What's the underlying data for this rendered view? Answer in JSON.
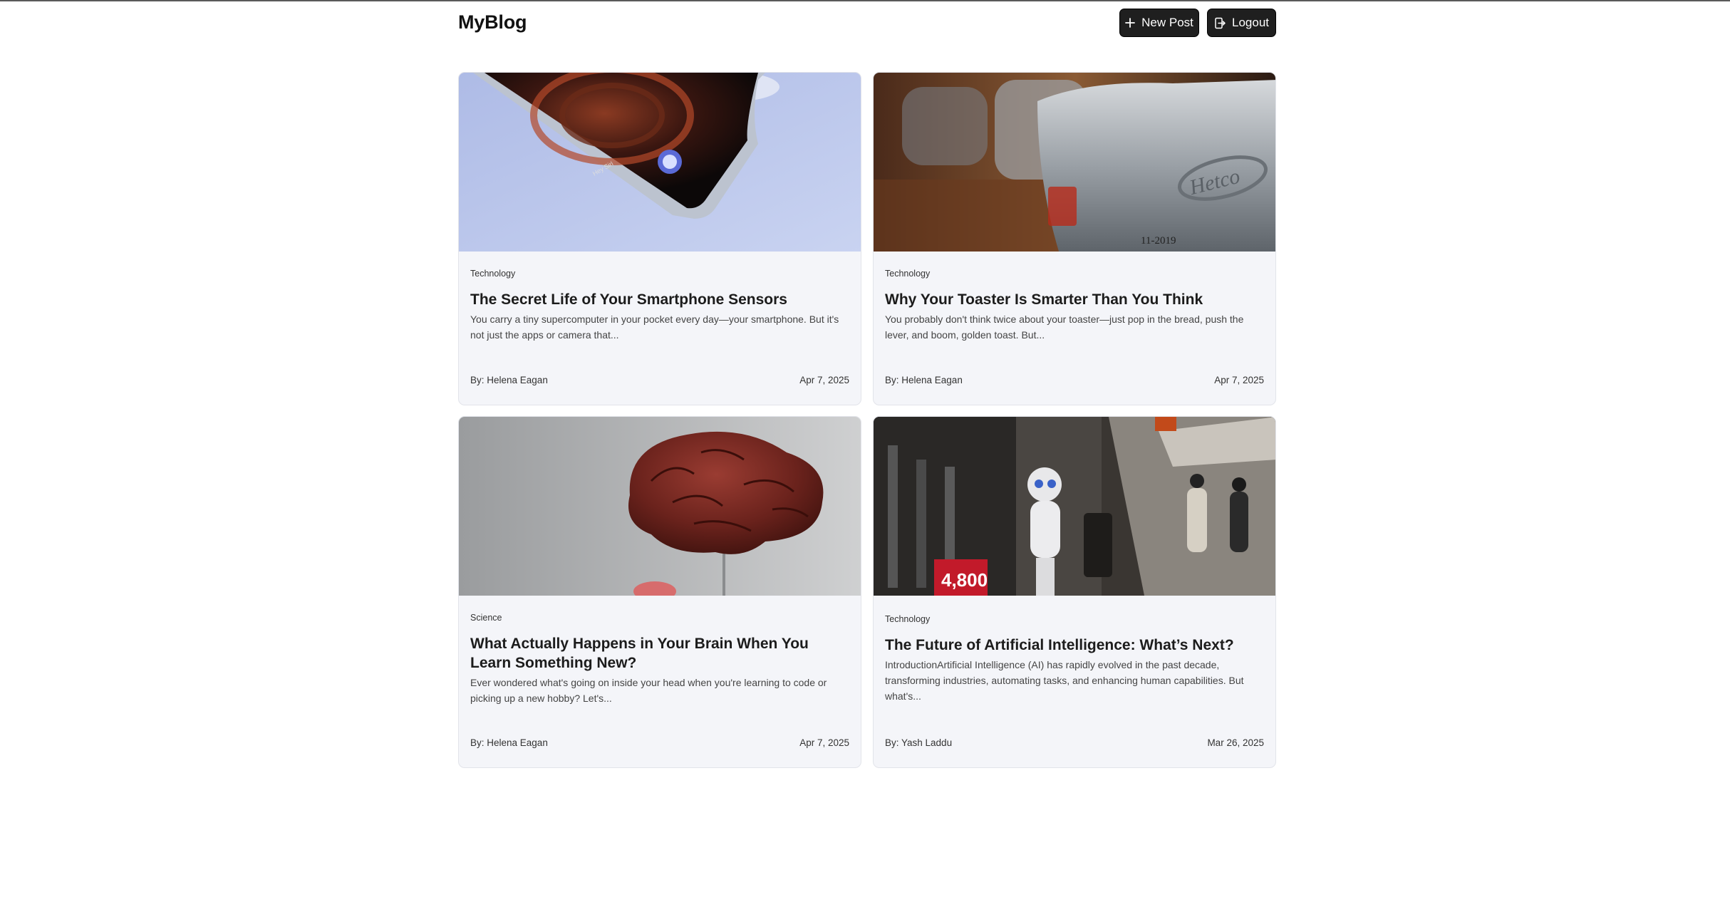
{
  "header": {
    "logo": "MyBlog",
    "new_post_label": "New Post",
    "logout_label": "Logout"
  },
  "posts": [
    {
      "image_icon": "smartphone-image",
      "category": "Technology",
      "title": "The Secret Life of Your Smartphone Sensors",
      "excerpt": "You carry a tiny supercomputer in your pocket every day—your smartphone. But it's not just the apps or camera that...",
      "author": "By: Helena Eagan",
      "date": "Apr 7, 2025"
    },
    {
      "image_icon": "toaster-image",
      "category": "Technology",
      "title": "Why Your Toaster Is Smarter Than You Think",
      "excerpt": "You probably don't think twice about your toaster—just pop in the bread, push the lever, and boom, golden toast. But...",
      "author": "By: Helena Eagan",
      "date": "Apr 7, 2025"
    },
    {
      "image_icon": "brain-model-image",
      "category": "Science",
      "title": "What Actually Happens in Your Brain When You Learn Something New?",
      "excerpt": "Ever wondered what's going on inside your head when you're learning to code or picking up a new hobby? Let's...",
      "author": "By: Helena Eagan",
      "date": "Apr 7, 2025"
    },
    {
      "image_icon": "robot-street-image",
      "category": "Technology",
      "title": "The Future of Artificial Intelligence: What’s Next?",
      "excerpt": "IntroductionArtificial Intelligence (AI) has rapidly evolved in the past decade, transforming industries, automating tasks, and enhancing human capabilities. But what's...",
      "author": "By: Yash Laddu",
      "date": "Mar 26, 2025"
    }
  ],
  "colors": {
    "button_bg": "#1f1f1f",
    "card_bg": "#f4f5f9",
    "card_border": "#e2e4ea"
  }
}
